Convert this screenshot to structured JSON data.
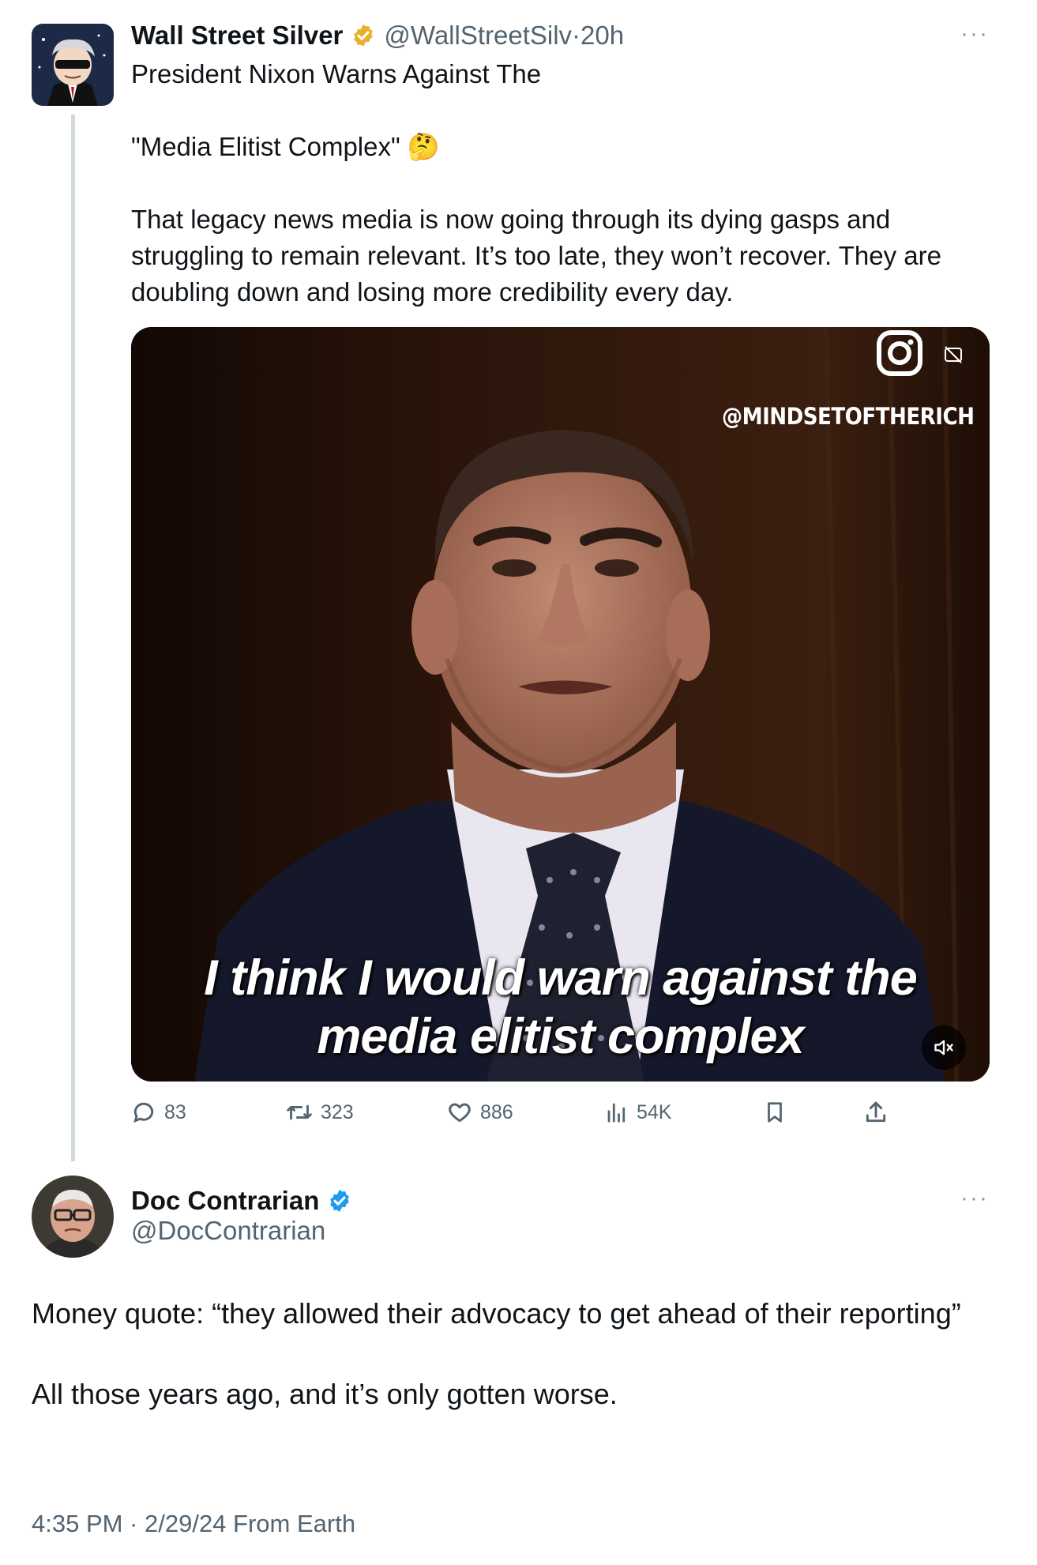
{
  "tweet1": {
    "display_name": "Wall Street Silver",
    "handle": "@WallStreetSilv",
    "separator": "·",
    "time": "20h",
    "more": "···",
    "text": "President Nixon Warns Against The\n\n\"Media Elitist Complex\" 🤔\n\nThat legacy news media is now going through its dying gasps and struggling to remain relevant. It’s too late, they won’t recover. They are doubling down and losing more credibility every day.",
    "media": {
      "watermark": "@MINDSETOFTHERICH",
      "caption_line1": "I think I would warn against the",
      "caption_line2": "media elitist complex",
      "icons": [
        "instagram-icon",
        "captions-icon",
        "mute-icon"
      ]
    },
    "actions": {
      "replies": "83",
      "retweets": "323",
      "likes": "886",
      "views": "54K"
    },
    "verified_color": "#e8b12a"
  },
  "tweet2": {
    "display_name": "Doc Contrarian",
    "handle": "@DocContrarian",
    "more": "···",
    "text": "Money quote: “they allowed their advocacy to get ahead of their reporting”\n\nAll those years ago, and it’s only gotten worse.",
    "timestamp": "4:35 PM · 2/29/24 From Earth",
    "verified_color": "#1d9bf0"
  }
}
